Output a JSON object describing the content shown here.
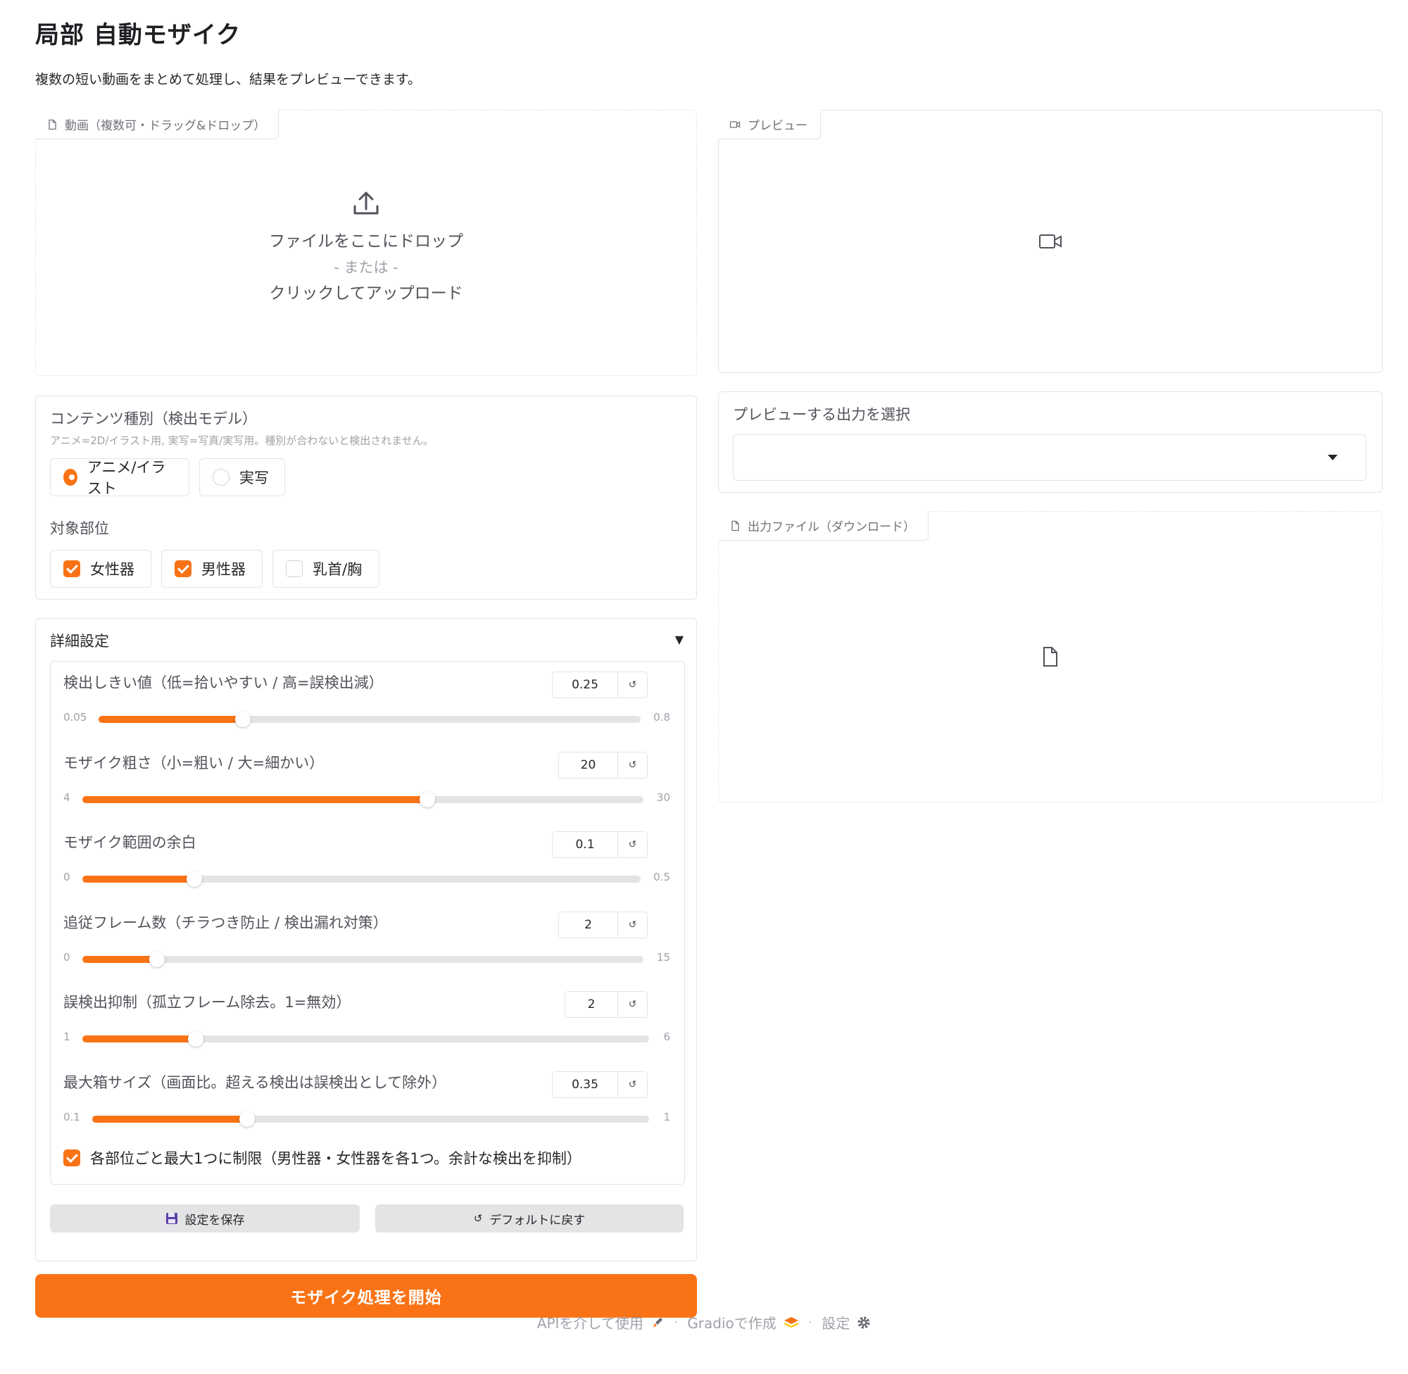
{
  "header": {
    "title": "局部 自動モザイク",
    "description": "複数の短い動画をまとめて処理し、結果をプレビューできます。"
  },
  "video_input": {
    "label": "動画（複数可・ドラッグ&ドロップ）",
    "drop_text": "ファイルをここにドロップ",
    "or_text": "- または -",
    "click_text": "クリックしてアップロード"
  },
  "preview": {
    "label": "プレビュー"
  },
  "preview_select": {
    "label": "プレビューする出力を選択",
    "value": ""
  },
  "output_files": {
    "label": "出力ファイル（ダウンロード）"
  },
  "content_type": {
    "label": "コンテンツ種別（検出モデル）",
    "info": "アニメ=2D/イラスト用, 実写=写真/実写用。種別が合わないと検出されません。",
    "options": [
      {
        "label": "アニメ/イラスト",
        "selected": true
      },
      {
        "label": "実写",
        "selected": false
      }
    ]
  },
  "target_parts": {
    "label": "対象部位",
    "options": [
      {
        "label": "女性器",
        "checked": true
      },
      {
        "label": "男性器",
        "checked": true
      },
      {
        "label": "乳首/胸",
        "checked": false
      }
    ]
  },
  "advanced": {
    "title": "詳細設定",
    "caret": "▼",
    "sliders": [
      {
        "label": "検出しきい値（低=拾いやすい / 高=誤検出減）",
        "value": "0.25",
        "min": "0.05",
        "max": "0.8",
        "v": 0.25,
        "lo": 0.05,
        "hi": 0.8
      },
      {
        "label": "モザイク粗さ（小=粗い / 大=細かい）",
        "value": "20",
        "min": "4",
        "max": "30",
        "v": 20,
        "lo": 4,
        "hi": 30
      },
      {
        "label": "モザイク範囲の余白",
        "value": "0.1",
        "min": "0",
        "max": "0.5",
        "v": 0.1,
        "lo": 0,
        "hi": 0.5
      },
      {
        "label": "追従フレーム数（チラつき防止 / 検出漏れ対策）",
        "value": "2",
        "min": "0",
        "max": "15",
        "v": 2,
        "lo": 0,
        "hi": 15
      },
      {
        "label": "誤検出抑制（孤立フレーム除去。1=無効）",
        "value": "2",
        "min": "1",
        "max": "6",
        "v": 2,
        "lo": 1,
        "hi": 6
      },
      {
        "label": "最大箱サイズ（画面比。超える検出は誤検出として除外）",
        "value": "0.35",
        "min": "0.1",
        "max": "1",
        "v": 0.35,
        "lo": 0.1,
        "hi": 1
      }
    ],
    "limit_checkbox": {
      "label": "各部位ごと最大1つに制限（男性器・女性器を各1つ。余計な検出を抑制）",
      "checked": true
    },
    "save_button": "設定を保存",
    "reset_button": "デフォルトに戻す"
  },
  "start_button": "モザイク処理を開始",
  "footer": {
    "api": "APIを介して使用",
    "gradio": "Gradioで作成",
    "settings": "設定"
  },
  "colors": {
    "accent": "#f97316",
    "border": "#e4e4e7",
    "muted": "#a1a1aa"
  }
}
